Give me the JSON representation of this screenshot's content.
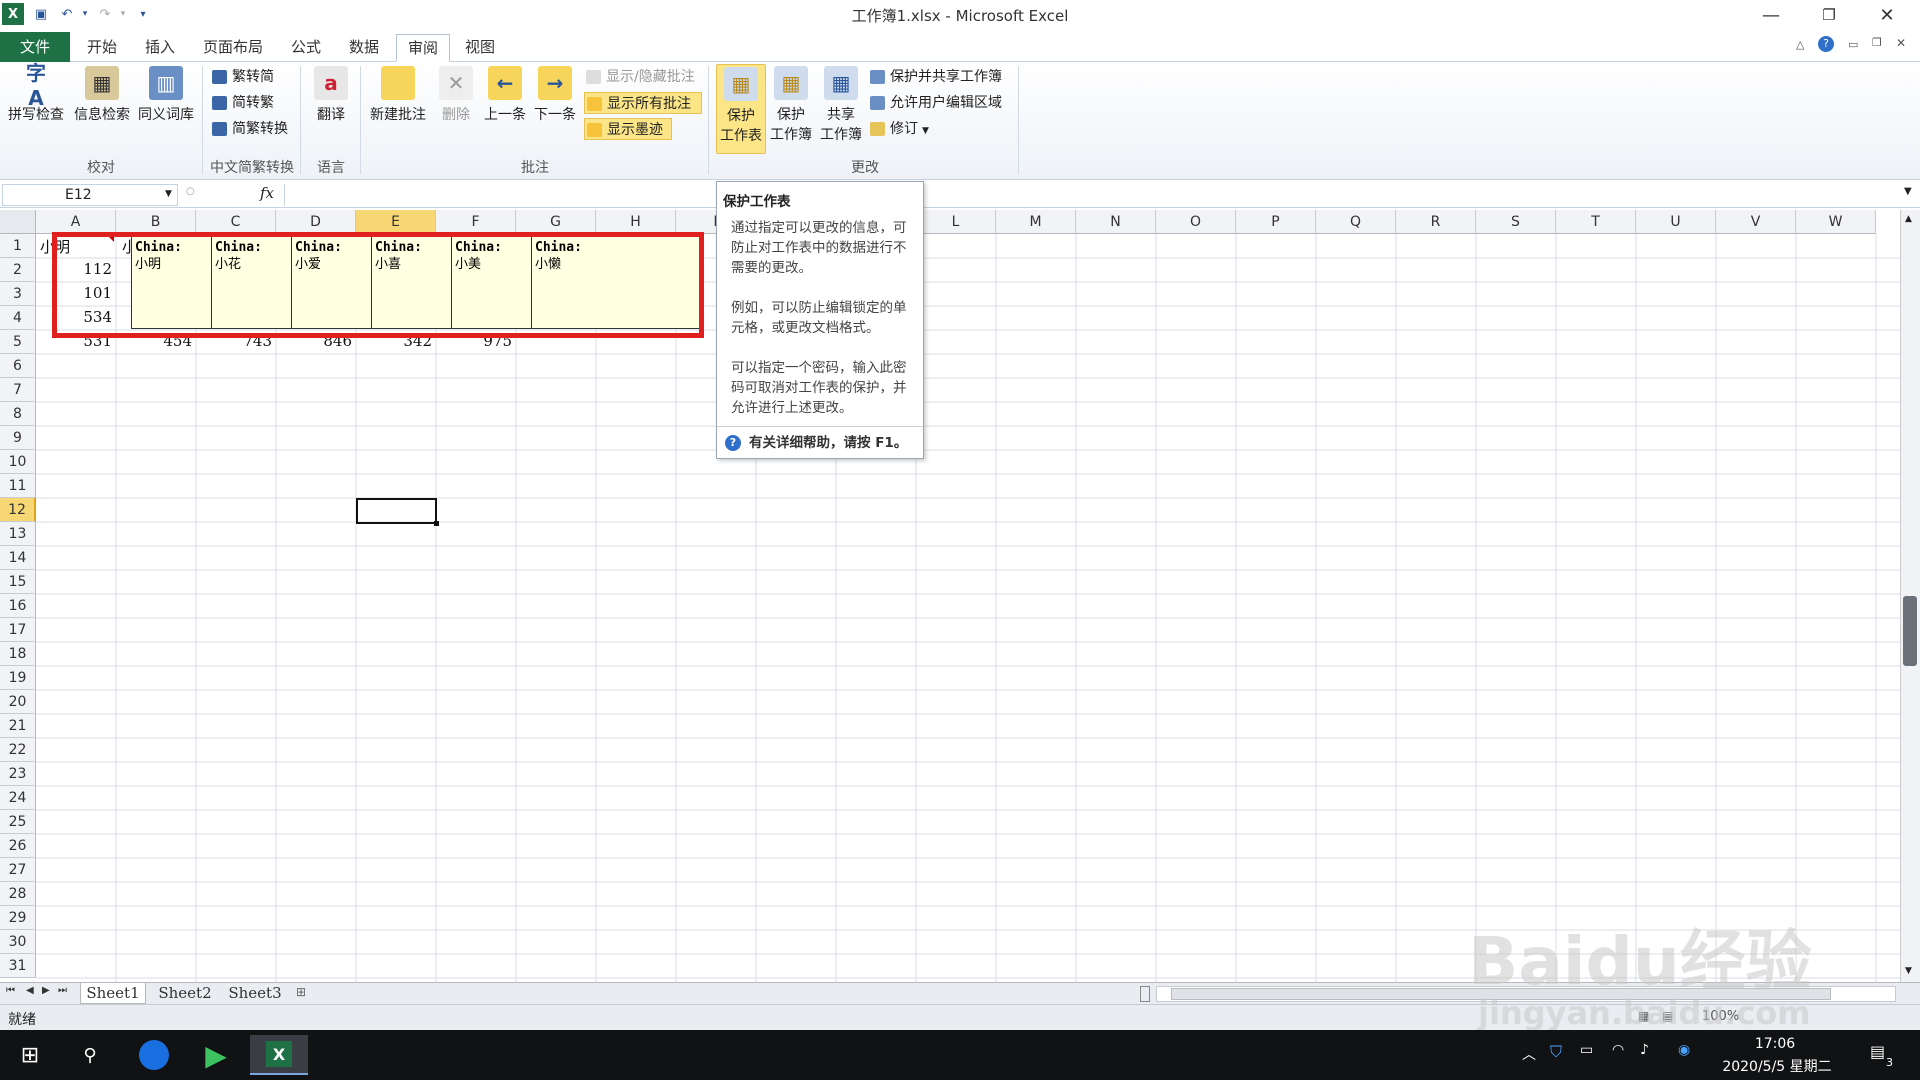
{
  "window": {
    "title": "工作簿1.xlsx - Microsoft Excel",
    "excel_green": "#1e7145",
    "highlight_yellow": "#fce586"
  },
  "tabs": [
    {
      "label": "文件"
    },
    {
      "label": "开始"
    },
    {
      "label": "插入"
    },
    {
      "label": "页面布局"
    },
    {
      "label": "公式"
    },
    {
      "label": "数据"
    },
    {
      "label": "审阅"
    },
    {
      "label": "视图"
    }
  ],
  "ribbon": {
    "proofing": {
      "group": "校对",
      "spell": "拼写检查",
      "research": "信息检索",
      "thesaurus": "同义词库"
    },
    "chinese": {
      "group": "中文简繁转换",
      "to_simplified": "繁转简",
      "to_traditional": "简转繁",
      "convert": "简繁转换"
    },
    "language": {
      "group": "语言",
      "translate": "翻译"
    },
    "comments": {
      "group": "批注",
      "new": "新建批注",
      "delete": "删除",
      "previous": "上一条",
      "next": "下一条",
      "show_hide": "显示/隐藏批注",
      "show_all": "显示所有批注",
      "show_ink": "显示墨迹"
    },
    "changes": {
      "group": "更改",
      "protect_sheet_1": "保护",
      "protect_sheet_2": "工作表",
      "protect_wb_1": "保护",
      "protect_wb_2": "工作簿",
      "share_wb_1": "共享",
      "share_wb_2": "工作簿",
      "protect_share": "保护并共享工作簿",
      "allow_edit": "允许用户编辑区域",
      "track": "修订"
    }
  },
  "formula_bar": {
    "name_box": "E12",
    "fx": "fx",
    "value": ""
  },
  "columns": [
    "A",
    "B",
    "C",
    "D",
    "E",
    "F",
    "G",
    "H",
    "I",
    "J",
    "K",
    "L",
    "M",
    "N",
    "O",
    "P",
    "Q",
    "R",
    "S",
    "T",
    "U",
    "V",
    "W"
  ],
  "rows": [
    "1",
    "2",
    "3",
    "4",
    "5",
    "6",
    "7",
    "8",
    "9",
    "10",
    "11",
    "12",
    "13",
    "14",
    "15",
    "16",
    "17",
    "18",
    "19",
    "20",
    "21",
    "22",
    "23",
    "24",
    "25",
    "26",
    "27",
    "28",
    "29",
    "30",
    "31"
  ],
  "cells": {
    "a1": "小明",
    "b1_fragment": "小",
    "a2": "112",
    "a3": "101",
    "a4": "534",
    "row5": [
      "531",
      "454",
      "743",
      "846",
      "342",
      "975"
    ]
  },
  "comments": [
    {
      "author": "China:",
      "text": "小明"
    },
    {
      "author": "China:",
      "text": "小花"
    },
    {
      "author": "China:",
      "text": "小爱"
    },
    {
      "author": "China:",
      "text": "小喜"
    },
    {
      "author": "China:",
      "text": "小美"
    },
    {
      "author": "China:",
      "text": "小懒"
    }
  ],
  "tooltip": {
    "title": "保护工作表",
    "p1": "通过指定可以更改的信息，可防止对工作表中的数据进行不需要的更改。",
    "p2": "例如，可以防止编辑锁定的单元格，或更改文档格式。",
    "p3": "可以指定一个密码，输入此密码可取消对工作表的保护，并允许进行上述更改。",
    "help": "有关详细帮助，请按 F1。"
  },
  "sheets": [
    "Sheet1",
    "Sheet2",
    "Sheet3"
  ],
  "status": {
    "ready": "就绪",
    "zoom": "100%"
  },
  "taskbar": {
    "time": "17:06",
    "date": "2020/5/5 星期二",
    "notifications": "3"
  },
  "watermark": {
    "brand": "Baidu经验",
    "url": "jingyan.baidu.com"
  }
}
